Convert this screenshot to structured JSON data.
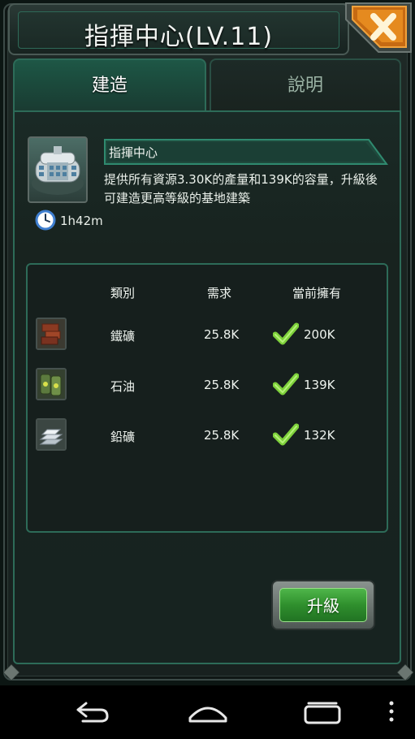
{
  "window": {
    "title": "指揮中心(LV.11)"
  },
  "tabs": [
    {
      "label": "建造",
      "active": true
    },
    {
      "label": "說明",
      "active": false
    }
  ],
  "building": {
    "name": "指揮中心",
    "description": "提供所有資源3.30K的產量和139K的容量，升級後可建造更高等級的基地建築",
    "build_time": "1h42m"
  },
  "requirements": {
    "headers": {
      "category": "類別",
      "required": "需求",
      "owned": "當前擁有"
    },
    "rows": [
      {
        "icon": "iron-ore-icon",
        "category": "鐵礦",
        "required": "25.8K",
        "owned": "200K",
        "met": true
      },
      {
        "icon": "oil-barrel-icon",
        "category": "石油",
        "required": "25.8K",
        "owned": "139K",
        "met": true
      },
      {
        "icon": "lead-ingot-icon",
        "category": "鉛礦",
        "required": "25.8K",
        "owned": "132K",
        "met": true
      }
    ]
  },
  "actions": {
    "upgrade_label": "升級"
  },
  "colors": {
    "accent": "#2d6b58",
    "active_tab": "#1e5746",
    "close_button": "#e58a1f",
    "upgrade_button": "#2f8f2d",
    "check_mark": "#7ed13b"
  },
  "navigation": [
    "back-icon",
    "home-icon",
    "recent-apps-icon",
    "overflow-menu-icon"
  ]
}
